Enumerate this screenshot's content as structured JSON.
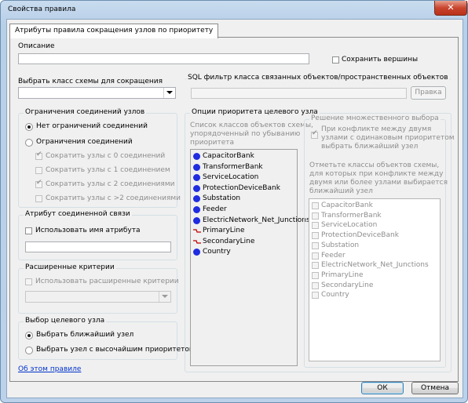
{
  "window": {
    "title": "Свойства правила",
    "close_glyph": "✕"
  },
  "tab": {
    "label": "Атрибуты правила сокращения узлов по приоритету"
  },
  "description": {
    "label": "Описание",
    "value": ""
  },
  "save_vertices": {
    "label": "Сохранить вершины",
    "checked": false
  },
  "schema_class": {
    "label": "Выбрать класс схемы для сокращения",
    "value": ""
  },
  "sql_filter": {
    "label": "SQL фильтр класса связанных объектов/пространственных объектов",
    "value": "",
    "button": "Правка"
  },
  "connection_limits": {
    "title": "Ограничения соединений узлов",
    "no_limits": "Нет ограничений соединений",
    "limits": "Ограничения соединений",
    "options": [
      {
        "label": "Сократить узлы с 0 соединений",
        "checked": true
      },
      {
        "label": "Сократить узлы с 1 соединением",
        "checked": false
      },
      {
        "label": "Сократить узлы с 2 соединениями",
        "checked": true
      },
      {
        "label": "Сократить узлы с >2 соединениями",
        "checked": false
      }
    ]
  },
  "link_attribute": {
    "title": "Атрибут соединенной связи",
    "use_attr": "Использовать имя атрибута",
    "value": ""
  },
  "extended": {
    "title": "Расширенные критерии",
    "use_extended": "Использовать расширенные критерии",
    "value": ""
  },
  "target_select": {
    "title": "Выбор целевого узла",
    "nearest": "Выбрать ближайший узел",
    "highest": "Выбрать узел с высочайшим приоритетом"
  },
  "priority": {
    "title": "Опции приоритета целевого узла",
    "desc": [
      "Список классов объектов схемы,",
      "упорядоченный по убыванию",
      "приоритета"
    ],
    "classes": [
      {
        "name": "CapacitorBank",
        "icon": "point-icon"
      },
      {
        "name": "TransformerBank",
        "icon": "point-icon"
      },
      {
        "name": "ServiceLocation",
        "icon": "point-icon"
      },
      {
        "name": "ProtectionDeviceBank",
        "icon": "point-icon"
      },
      {
        "name": "Substation",
        "icon": "point-icon"
      },
      {
        "name": "Feeder",
        "icon": "point-icon"
      },
      {
        "name": "ElectricNetwork_Net_Junctions",
        "icon": "point-icon"
      },
      {
        "name": "PrimaryLine",
        "icon": "line-icon"
      },
      {
        "name": "SecondaryLine",
        "icon": "line-icon"
      },
      {
        "name": "Country",
        "icon": "point-icon"
      }
    ],
    "point_color": "#1f2ce0",
    "line_color": "#c00000"
  },
  "multi": {
    "title": "Решение множественного выбора",
    "conflict": [
      "При конфликте между двумя",
      "узлами с одинаковым приоритетом",
      "выбрать ближайший узел"
    ],
    "note": [
      "Отметьте классы объектов схемы,",
      "для которых при конфликте между",
      "двумя или более узлами выбирается",
      "ближайший узел"
    ],
    "classes": [
      "CapacitorBank",
      "TransformerBank",
      "ServiceLocation",
      "ProtectionDeviceBank",
      "Substation",
      "Feeder",
      "ElectricNetwork_Net_Junctions",
      "PrimaryLine",
      "SecondaryLine",
      "Country"
    ]
  },
  "about_link": "Об этом правиле",
  "buttons": {
    "ok": "ОК",
    "cancel": "Отмена"
  }
}
